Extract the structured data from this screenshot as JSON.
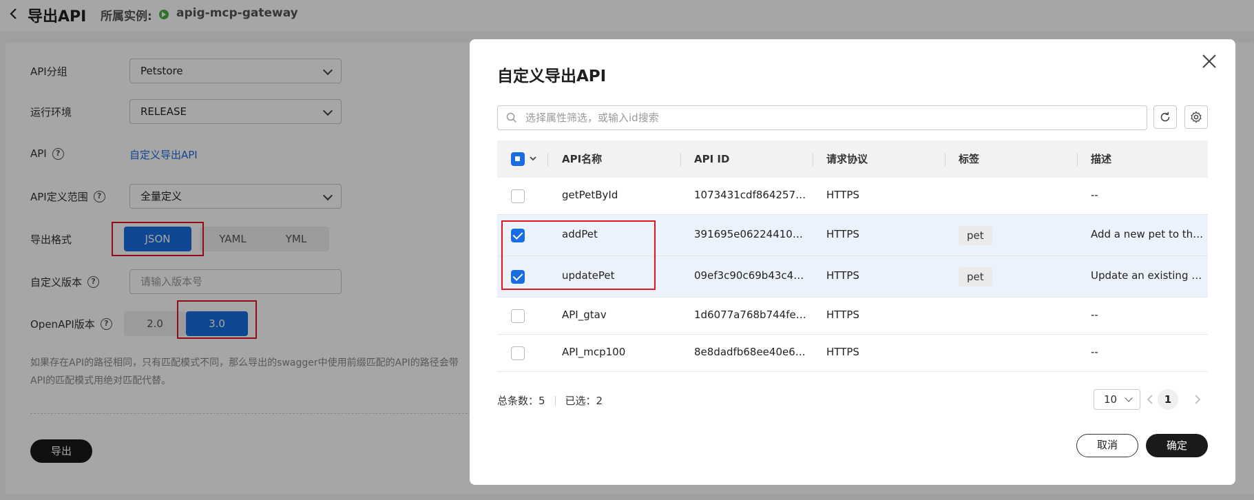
{
  "header": {
    "title": "导出API",
    "instance_label": "所属实例:",
    "instance_name": "apig-mcp-gateway"
  },
  "form": {
    "api_group": {
      "label": "API分组",
      "value": "Petstore"
    },
    "environment": {
      "label": "运行环境",
      "value": "RELEASE"
    },
    "api": {
      "label": "API",
      "link": "自定义导出API"
    },
    "scope": {
      "label": "API定义范围",
      "value": "全量定义"
    },
    "format": {
      "label": "导出格式",
      "options": [
        "JSON",
        "YAML",
        "YML"
      ],
      "selected": "JSON"
    },
    "custom_version": {
      "label": "自定义版本",
      "placeholder": "请输入版本号"
    },
    "openapi": {
      "label": "OpenAPI版本",
      "options": [
        "2.0",
        "3.0"
      ],
      "selected": "3.0"
    },
    "note_line1": "如果存在API的路径相同，只有匹配模式不同，那么导出的swagger中使用前缀匹配的API的路径会带",
    "note_line2": "API的匹配模式用绝对匹配代替。",
    "export_button": "导出"
  },
  "modal": {
    "title": "自定义导出API",
    "search_placeholder": "选择属性筛选，或输入id搜索",
    "columns": [
      "API名称",
      "API ID",
      "请求协议",
      "标签",
      "描述"
    ],
    "rows": [
      {
        "name": "getPetById",
        "id": "1073431cdf864257a...",
        "protocol": "HTTPS",
        "tag": "",
        "desc": "--",
        "checked": false
      },
      {
        "name": "addPet",
        "id": "391695e06224410e...",
        "protocol": "HTTPS",
        "tag": "pet",
        "desc": "Add a new pet to the...",
        "checked": true
      },
      {
        "name": "updatePet",
        "id": "09ef3c90c69b43c48...",
        "protocol": "HTTPS",
        "tag": "pet",
        "desc": "Update an existing p...",
        "checked": true
      },
      {
        "name": "API_gtav",
        "id": "1d6077a768b744fe9...",
        "protocol": "HTTPS",
        "tag": "",
        "desc": "--",
        "checked": false
      },
      {
        "name": "API_mcp100",
        "id": "8e8dadfb68ee40e68...",
        "protocol": "HTTPS",
        "tag": "",
        "desc": "--",
        "checked": false
      }
    ],
    "total_label": "总条数：5",
    "selected_label": "已选：2",
    "page_size": "10",
    "current_page": "1",
    "cancel": "取消",
    "ok": "确定"
  },
  "colors": {
    "primary": "#1a6de0",
    "dark_button": "#1a1a1a",
    "highlight_box": "#e0141e",
    "status_green": "#4bb040"
  }
}
